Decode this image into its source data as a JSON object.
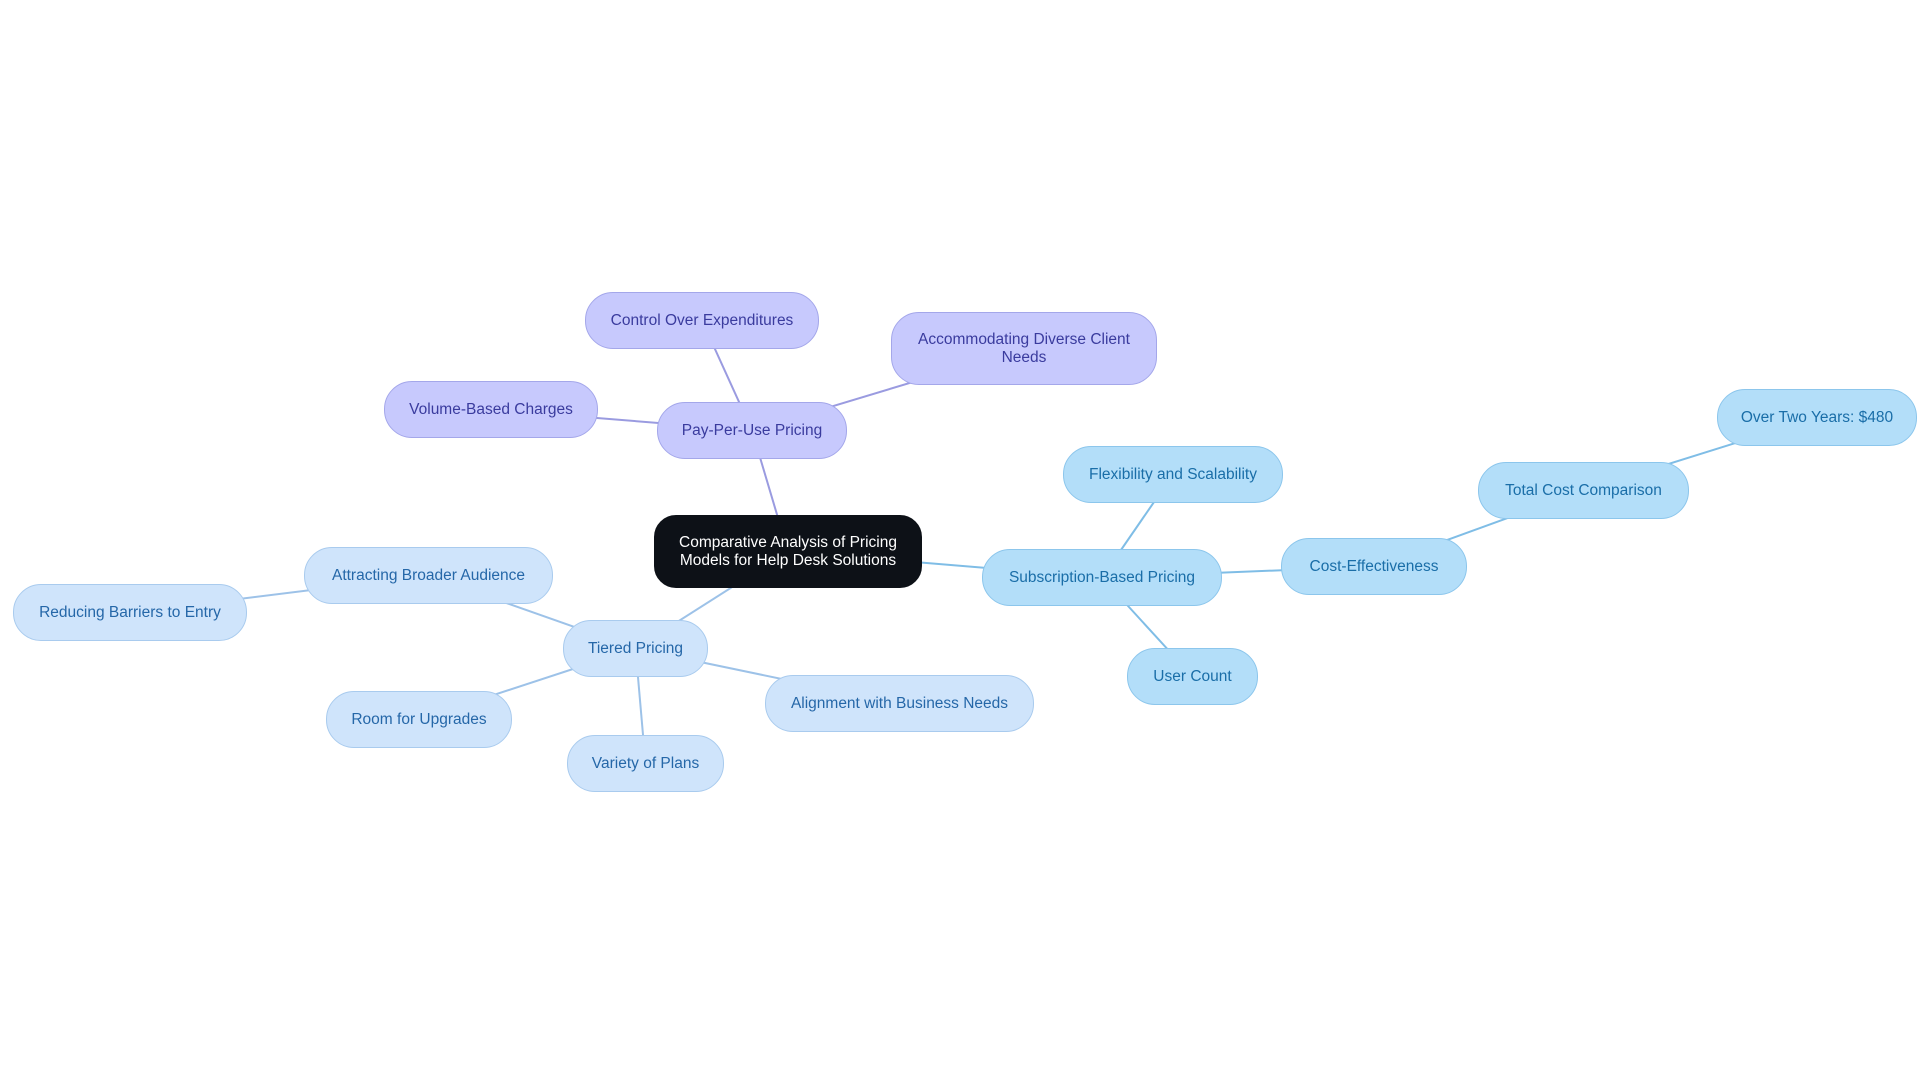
{
  "diagram": {
    "type": "mindmap",
    "colors": {
      "root_bg": "#0d1117",
      "pay_per_use_branch": "#c7c9fd",
      "subscription_branch": "#b3def9",
      "tiered_branch": "#cfe4fb",
      "edge_purple": "#9a9be0",
      "edge_sky": "#7fbde6",
      "edge_pale": "#9dc2e8"
    },
    "root": {
      "id": "root",
      "label": "Comparative Analysis of Pricing Models for Help Desk Solutions"
    },
    "nodes": [
      {
        "id": "ppu",
        "label": "Pay-Per-Use Pricing",
        "parent": "root"
      },
      {
        "id": "ctrl",
        "label": "Control Over Expenditures",
        "parent": "ppu"
      },
      {
        "id": "acc",
        "label": "Accommodating Diverse Client Needs",
        "parent": "ppu"
      },
      {
        "id": "vol",
        "label": "Volume-Based Charges",
        "parent": "ppu"
      },
      {
        "id": "sub",
        "label": "Subscription-Based Pricing",
        "parent": "root"
      },
      {
        "id": "flex",
        "label": "Flexibility and Scalability",
        "parent": "sub"
      },
      {
        "id": "user",
        "label": "User Count",
        "parent": "sub"
      },
      {
        "id": "cost",
        "label": "Cost-Effectiveness",
        "parent": "sub"
      },
      {
        "id": "total",
        "label": "Total Cost Comparison",
        "parent": "cost"
      },
      {
        "id": "two",
        "label": "Over Two Years: $480",
        "parent": "total"
      },
      {
        "id": "tier",
        "label": "Tiered Pricing",
        "parent": "root"
      },
      {
        "id": "attr",
        "label": "Attracting Broader Audience",
        "parent": "tier"
      },
      {
        "id": "redu",
        "label": "Reducing Barriers to Entry",
        "parent": "attr"
      },
      {
        "id": "room",
        "label": "Room for Upgrades",
        "parent": "tier"
      },
      {
        "id": "var",
        "label": "Variety of Plans",
        "parent": "tier"
      },
      {
        "id": "align",
        "label": "Alignment with Business Needs",
        "parent": "tier"
      }
    ]
  }
}
